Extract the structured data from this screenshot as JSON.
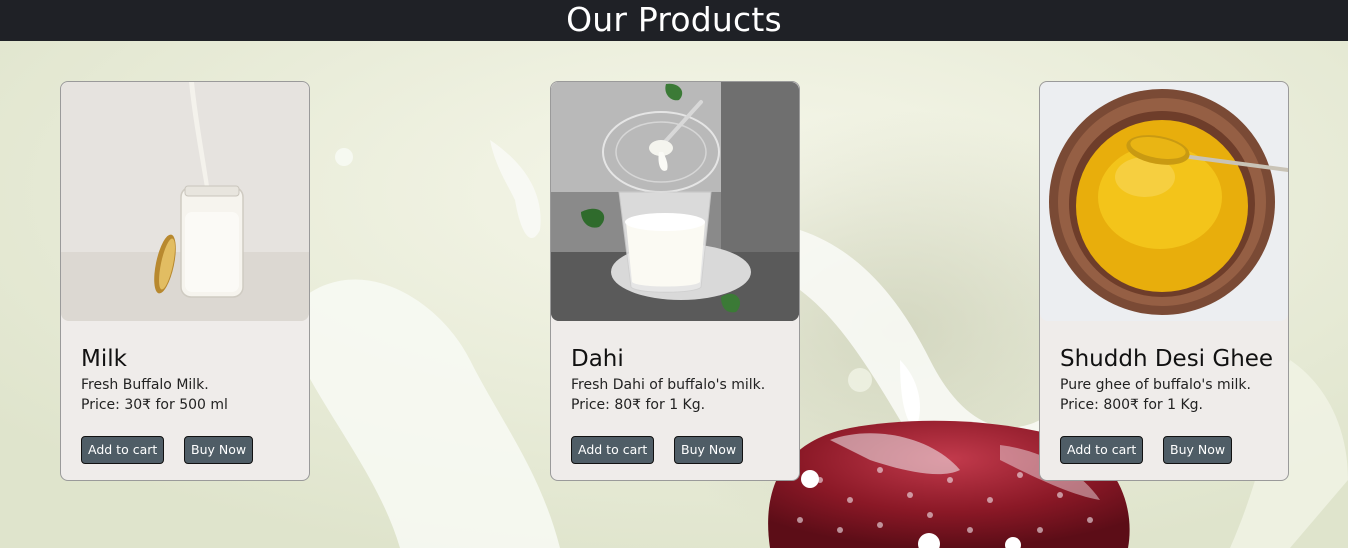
{
  "header": {
    "title": "Our Products"
  },
  "colors": {
    "header_bg": "#1f2126",
    "card_bg": "#efecea",
    "button_bg": "#4f5d66"
  },
  "products": [
    {
      "name": "Milk",
      "description": "Fresh Buffalo Milk.",
      "price": "Price: 30₹ for 500 ml",
      "add_to_cart_label": "Add to cart",
      "buy_now_label": "Buy Now"
    },
    {
      "name": "Dahi",
      "description": "Fresh Dahi of buffalo's milk.",
      "price": "Price: 80₹ for 1 Kg.",
      "add_to_cart_label": "Add to cart",
      "buy_now_label": "Buy Now"
    },
    {
      "name": "Shuddh Desi Ghee",
      "description": "Pure ghee of buffalo's milk.",
      "price": "Price: 800₹ for 1 Kg.",
      "add_to_cart_label": "Add to cart",
      "buy_now_label": "Buy Now"
    }
  ]
}
